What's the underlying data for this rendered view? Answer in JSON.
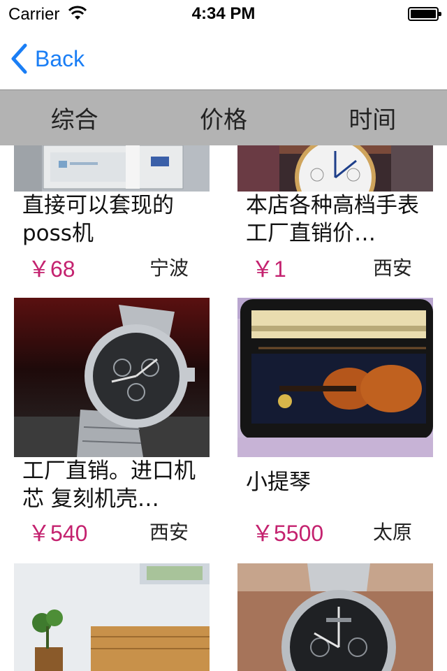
{
  "status_bar": {
    "carrier": "Carrier",
    "time": "4:34 PM"
  },
  "nav": {
    "back_label": "Back"
  },
  "sort_tabs": [
    "综合",
    "价格",
    "时间"
  ],
  "products": [
    {
      "title": "直接可以套现的poss机",
      "price": "￥68",
      "city": "宁波",
      "image_icon": "pos-terminal-photo"
    },
    {
      "title": "本店各种高档手表 工厂直销价…",
      "price": "￥1",
      "city": "西安",
      "image_icon": "watch-photo"
    },
    {
      "title": "工厂直销。进口机芯 复刻机壳…",
      "price": "￥540",
      "city": "西安",
      "image_icon": "steel-watch-photo"
    },
    {
      "title": "小提琴",
      "price": "￥5500",
      "city": "太原",
      "image_icon": "violin-case-photo"
    },
    {
      "title": "",
      "price": "",
      "city": "",
      "image_icon": "bedroom-photo"
    },
    {
      "title": "",
      "price": "",
      "city": "",
      "image_icon": "longines-watch-photo"
    }
  ],
  "colors": {
    "accent": "#1a7ef5",
    "price": "#c4226f",
    "sort_bar": "#b3b3b3"
  }
}
